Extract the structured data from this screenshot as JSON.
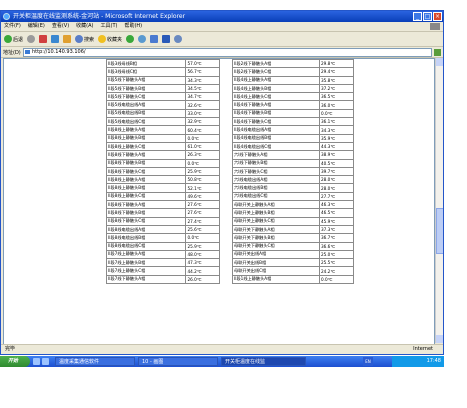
{
  "window": {
    "title": "开关柜温度在线监测系统-金河站 - Microsoft Internet Explorer",
    "menu": [
      "文件(F)",
      "编辑(E)",
      "查看(V)",
      "收藏(A)",
      "工具(T)",
      "帮助(H)"
    ],
    "toolbar": {
      "back": "后退",
      "search": "搜索",
      "favorites": "收藏夹"
    },
    "address_label": "地址(D)",
    "address_value": "http://10.140.93.106/"
  },
  "table_left": [
    [
      "II段3线母线B相",
      "57.0℃"
    ],
    [
      "II段3线母线C相",
      "56.7℃"
    ],
    [
      "II段5线下静触头A相",
      "34.3℃"
    ],
    [
      "II段5线下静触头B相",
      "34.5℃"
    ],
    [
      "II段5线下静触头C相",
      "34.7℃"
    ],
    [
      "II段5线电缆出线A相",
      "32.6℃"
    ],
    [
      "II段5线电缆出线B相",
      "33.0℃"
    ],
    [
      "II段5线电缆出线C相",
      "32.9℃"
    ],
    [
      "II段8线上静触头A相",
      "60.4℃"
    ],
    [
      "II段8线上静触头B相",
      "0.0℃"
    ],
    [
      "II段8线上静触头C相",
      "61.0℃"
    ],
    [
      "II段8线下静触头A相",
      "26.3℃"
    ],
    [
      "II段8线下静触头B相",
      "0.0℃"
    ],
    [
      "II段8线下静触头C相",
      "25.9℃"
    ],
    [
      "II段8线上静触头A相",
      "50.8℃"
    ],
    [
      "II段8线上静触头B相",
      "52.1℃"
    ],
    [
      "II段8线上静触头C相",
      "49.6℃"
    ],
    [
      "II段8线下静触头A相",
      "27.6℃"
    ],
    [
      "II段8线下静触头B相",
      "27.6℃"
    ],
    [
      "II段8线下静触头C相",
      "27.4℃"
    ],
    [
      "II段8线电缆出线A相",
      "25.6℃"
    ],
    [
      "II段8线电缆出线B相",
      "0.0℃"
    ],
    [
      "II段8线电缆出线C相",
      "25.9℃"
    ],
    [
      "II段7线上静触头A相",
      "48.0℃"
    ],
    [
      "II段7线上静触头B相",
      "47.3℃"
    ],
    [
      "II段7线上静触头C相",
      "44.2℃"
    ],
    [
      "II段7线下静触头A相",
      "26.0℃"
    ]
  ],
  "table_right": [
    [
      "II段2线下静触头A相",
      "29.8℃"
    ],
    [
      "II段2线下静触头C相",
      "29.4℃"
    ],
    [
      "II段4线上静触头A相",
      "35.8℃"
    ],
    [
      "II段4线上静触头B相",
      "37.2℃"
    ],
    [
      "II段4线上静触头C相",
      "36.5℃"
    ],
    [
      "II段4线下静触头A相",
      "36.0℃"
    ],
    [
      "II段4线下静触头B相",
      "0.0℃"
    ],
    [
      "II段4线下静触头C相",
      "36.1℃"
    ],
    [
      "II段4线电缆出线A相",
      "34.3℃"
    ],
    [
      "II段4线电缆出线B相",
      "35.9℃"
    ],
    [
      "II段4线电缆出线C相",
      "44.3℃"
    ],
    [
      "六I线下静触头A相",
      "38.9℃"
    ],
    [
      "六I线下静触头B相",
      "40.5℃"
    ],
    [
      "六I线下静触头C相",
      "39.7℃"
    ],
    [
      "六I线电缆出线A相",
      "28.0℃"
    ],
    [
      "六I线电缆出线B相",
      "28.0℃"
    ],
    [
      "六I线电缆出线C相",
      "27.7℃"
    ],
    [
      "母联开关上静触头A相",
      "46.3℃"
    ],
    [
      "母联开关上静触头B相",
      "46.5℃"
    ],
    [
      "母联开关上静触头C相",
      "45.9℃"
    ],
    [
      "母联开关下静触头A相",
      "37.3℃"
    ],
    [
      "母联开关下静触头B相",
      "36.7℃"
    ],
    [
      "母联开关下静触头C相",
      "36.6℃"
    ],
    [
      "母联开关出线A相",
      "25.0℃"
    ],
    [
      "母联开关出线B相",
      "25.5℃"
    ],
    [
      "母联开关出线C相",
      "24.2℃"
    ],
    [
      "II段1线上静触头A相",
      "0.0℃"
    ]
  ],
  "statusbar": {
    "left": "完毕",
    "right": "Internet"
  },
  "taskbar": {
    "start": "开始",
    "tasks": [
      "温度采集通信软件",
      "10 - 画图",
      "开关柜温度在线监"
    ],
    "lang": "EN",
    "clock": "17:48"
  },
  "colors": {
    "titlebar": "#0a3fb8",
    "taskbar": "#1d4fd0",
    "start": "#2f8a2f"
  }
}
